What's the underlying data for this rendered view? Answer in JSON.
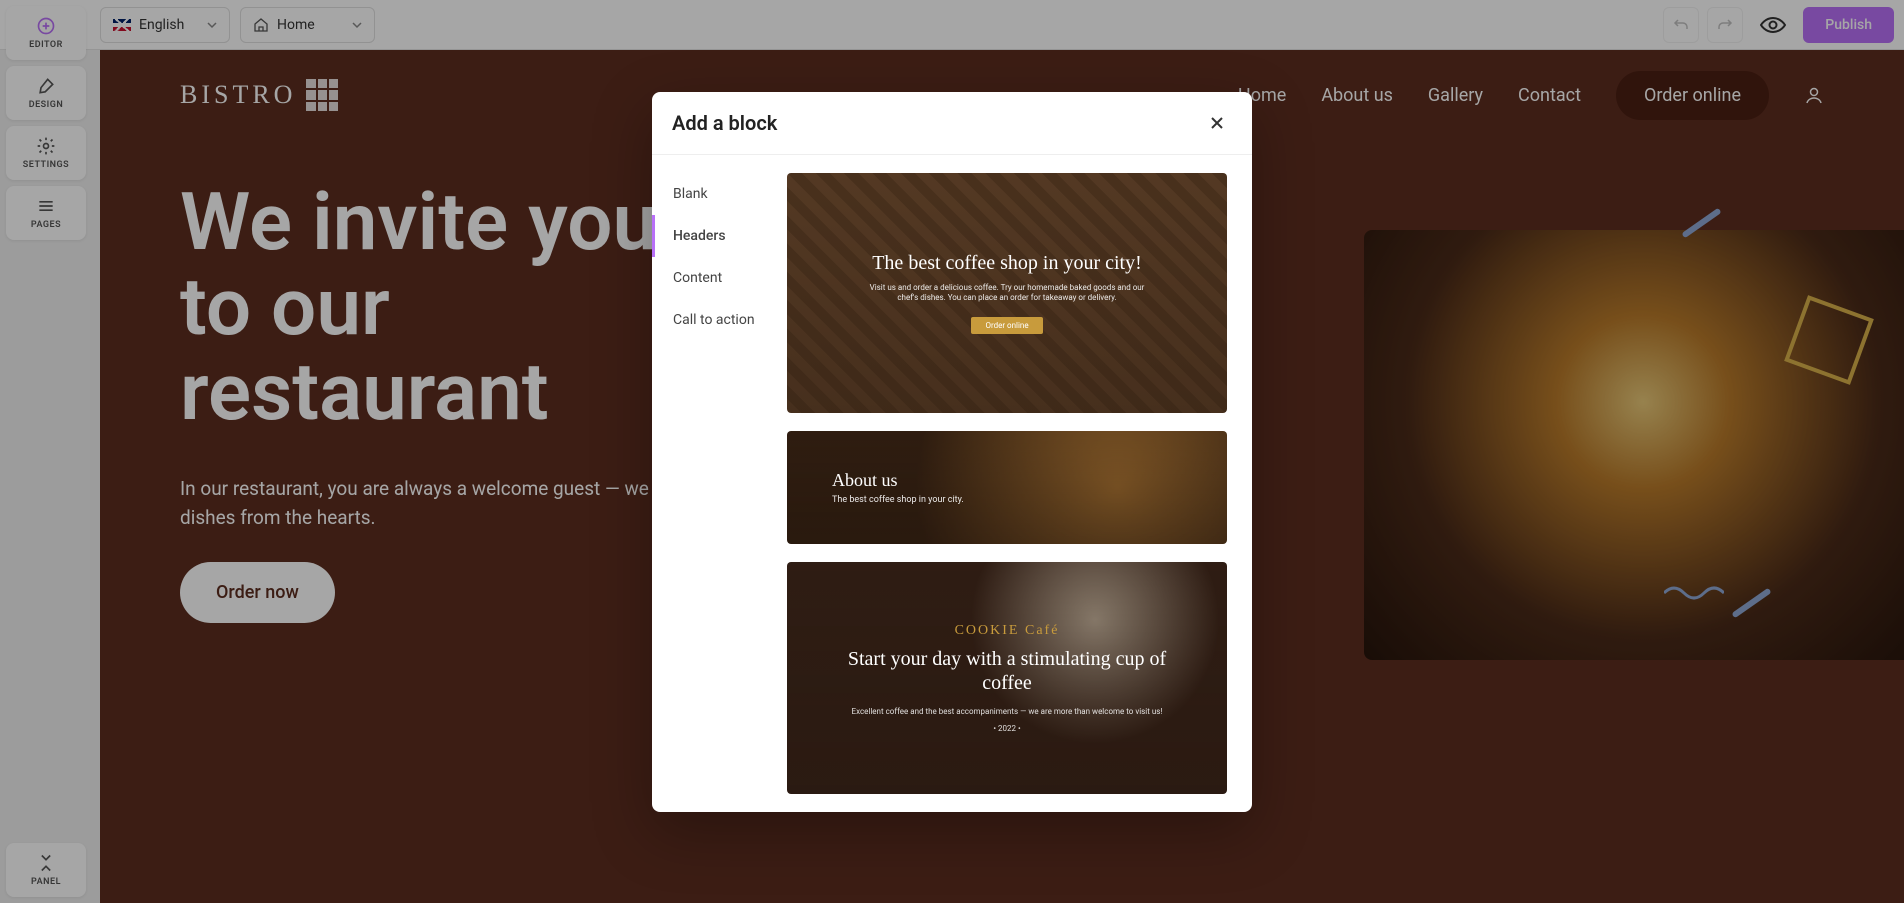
{
  "toolbar": {
    "language_label": "English",
    "page_label": "Home",
    "publish_label": "Publish"
  },
  "sidebar": {
    "items": [
      {
        "label": "EDITOR"
      },
      {
        "label": "DESIGN"
      },
      {
        "label": "SETTINGS"
      },
      {
        "label": "PAGES"
      }
    ],
    "panel_label": "PANEL"
  },
  "site": {
    "logo_text": "BISTRO",
    "nav": {
      "home": "Home",
      "about": "About us",
      "gallery": "Gallery",
      "contact": "Contact",
      "order_online": "Order online"
    },
    "hero": {
      "title_line1": "We invite you",
      "title_line2": "to our",
      "title_line3": "restaurant",
      "subtitle": "In our restaurant, you are always a welcome guest — we serve dishes from the hearts.",
      "cta": "Order now"
    }
  },
  "modal": {
    "title": "Add a block",
    "categories": [
      {
        "label": "Blank"
      },
      {
        "label": "Headers"
      },
      {
        "label": "Content"
      },
      {
        "label": "Call to action"
      }
    ],
    "active_category_index": 1,
    "previews": {
      "p1": {
        "title": "The best coffee shop in your city!",
        "subtitle": "Visit us and order a delicious coffee. Try our homemade baked goods and our chef's dishes. You can place an order for takeaway or delivery.",
        "button": "Order online"
      },
      "p2": {
        "title": "About us",
        "subtitle": "The best coffee shop in your city."
      },
      "p3": {
        "brand": "COOKIE Café",
        "title": "Start your day with a stimulating cup of coffee",
        "subtitle": "Excellent coffee and the best accompaniments — we are more than welcome to visit us!",
        "year": "• 2022 •"
      }
    }
  }
}
